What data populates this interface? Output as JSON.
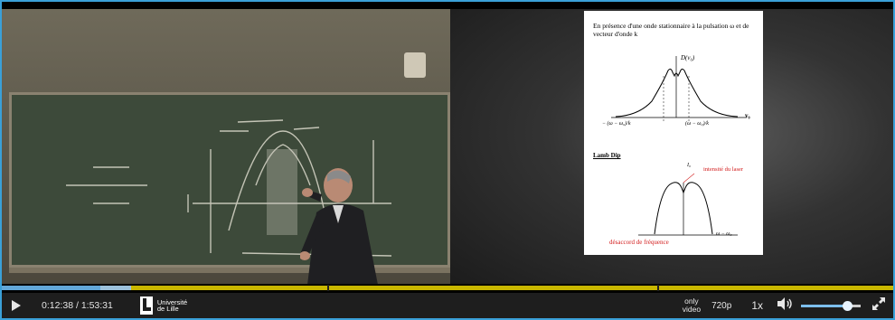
{
  "player": {
    "current_time": "0:12:38",
    "separator": " / ",
    "duration": "1:53:31",
    "progress_fraction": 0.111,
    "buffered_fraction": 0.145,
    "audio_mode_line1": "only",
    "audio_mode_line2": "video",
    "quality": "720p",
    "speed": "1x",
    "volume_fraction": 0.78,
    "accent_color": "#3aa0d8",
    "timeline_color": "#c9b700"
  },
  "logo": {
    "line1": "Université",
    "line2": "de Lille"
  },
  "slide": {
    "intro": "En présence d'une onde stationnaire à la pulsation ω et de vecteur d'onde k",
    "graph1_top_label": "D(v₀)",
    "graph1_left_label": "− (ω − ω₀)/k",
    "graph1_right_label": "(ω − ω₀)/k",
    "graph1_axis": "v₀",
    "lamb_dip": "Lamb Dip",
    "graph2_top_label": "I₀",
    "intensity_label": "intensité du laser",
    "graph2_axis": "ω − ω₀",
    "detuning_label": "désaccord de fréquence"
  },
  "icons": {
    "play": "play-icon",
    "volume": "volume-icon",
    "fullscreen": "fullscreen-icon"
  }
}
